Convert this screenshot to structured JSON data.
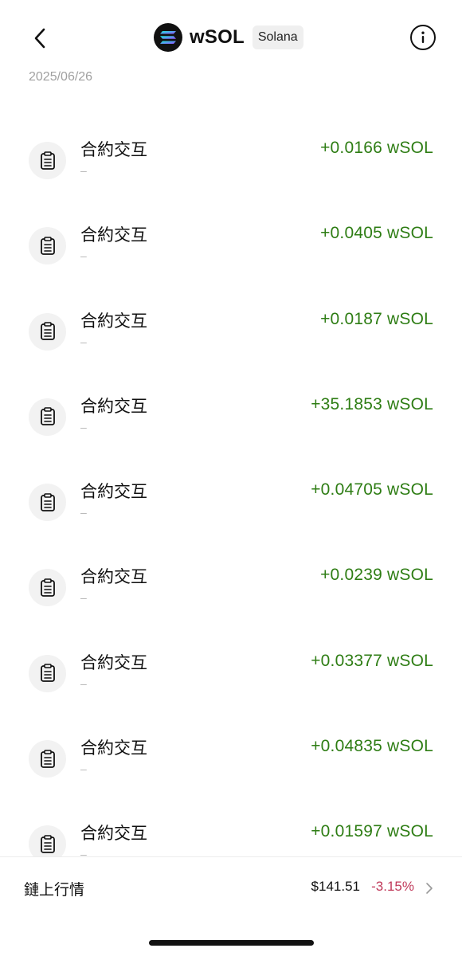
{
  "header": {
    "back_icon": "chevron-left-icon",
    "token_logo": "solana-logo",
    "token_name": "wSOL",
    "chain_badge": "Solana",
    "info_icon": "info-icon"
  },
  "date": "2025/06/26",
  "transactions": [
    {
      "title": "合約交互",
      "sub": "–",
      "amount": "+0.0166 wSOL",
      "icon": "clipboard-icon"
    },
    {
      "title": "合約交互",
      "sub": "–",
      "amount": "+0.0405 wSOL",
      "icon": "clipboard-icon"
    },
    {
      "title": "合約交互",
      "sub": "–",
      "amount": "+0.0187 wSOL",
      "icon": "clipboard-icon"
    },
    {
      "title": "合約交互",
      "sub": "–",
      "amount": "+35.1853 wSOL",
      "icon": "clipboard-icon"
    },
    {
      "title": "合約交互",
      "sub": "–",
      "amount": "+0.04705 wSOL",
      "icon": "clipboard-icon"
    },
    {
      "title": "合約交互",
      "sub": "–",
      "amount": "+0.0239 wSOL",
      "icon": "clipboard-icon"
    },
    {
      "title": "合約交互",
      "sub": "–",
      "amount": "+0.03377 wSOL",
      "icon": "clipboard-icon"
    },
    {
      "title": "合約交互",
      "sub": "–",
      "amount": "+0.04835 wSOL",
      "icon": "clipboard-icon"
    },
    {
      "title": "合約交互",
      "sub": "–",
      "amount": "+0.01597 wSOL",
      "icon": "clipboard-icon"
    }
  ],
  "market": {
    "label": "鏈上行情",
    "price": "$141.51",
    "change": "-3.15%",
    "chevron_icon": "chevron-right-icon"
  },
  "colors": {
    "positive_amount": "#2e7d14",
    "negative_change": "#c0395a",
    "date_text": "#a0a0a0"
  }
}
